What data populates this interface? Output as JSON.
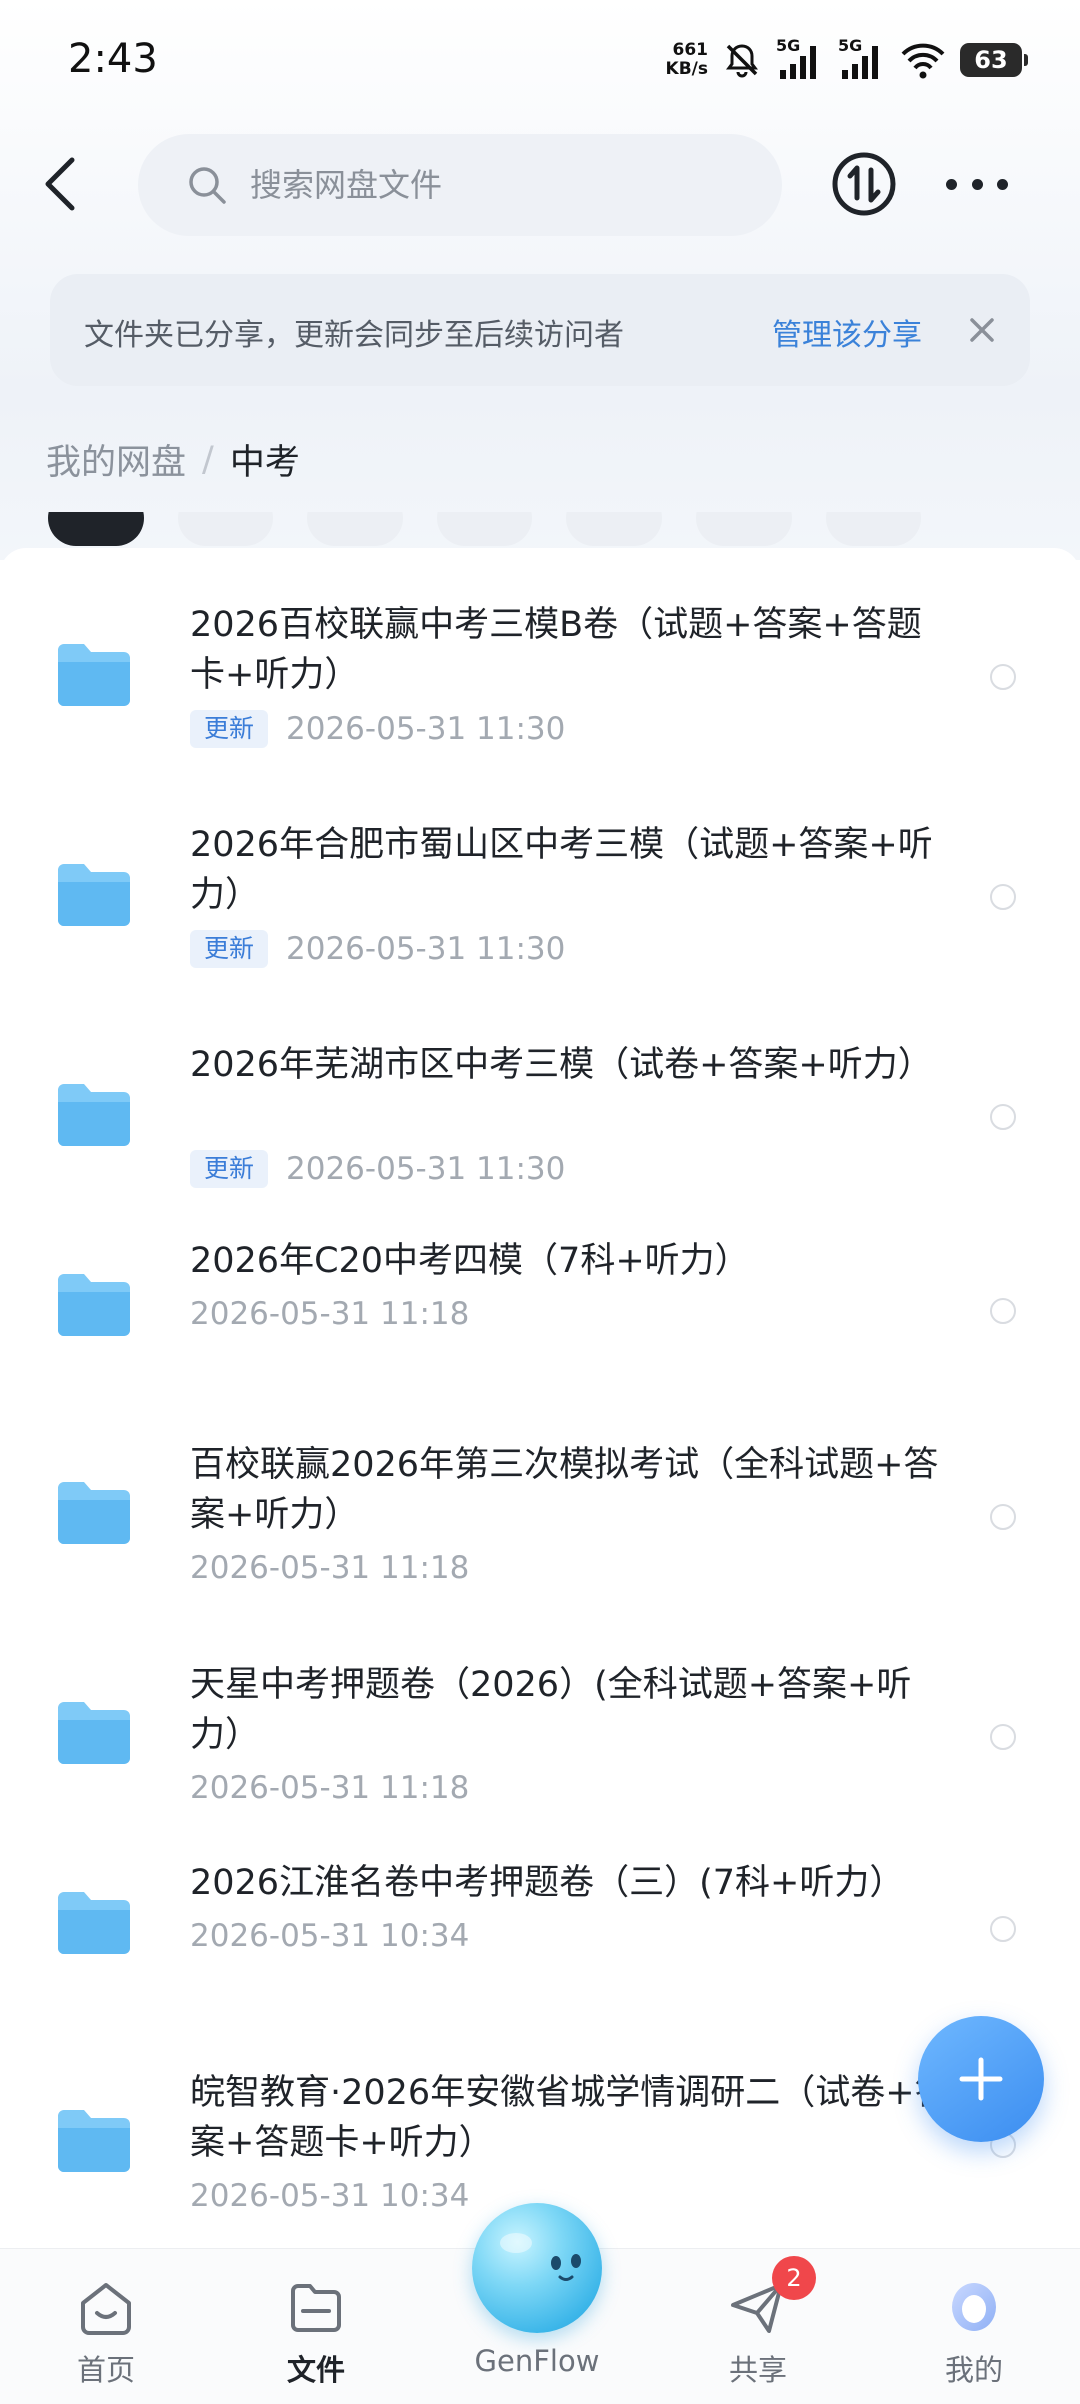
{
  "status": {
    "time": "2:43",
    "speed_value": "661",
    "speed_unit": "KB/s",
    "sim1": "5G",
    "sim2": "5G",
    "battery": "63"
  },
  "header": {
    "search_placeholder": "搜索网盘文件"
  },
  "notice": {
    "text": "文件夹已分享，更新会同步至后续访问者",
    "link": "管理该分享"
  },
  "breadcrumb": {
    "root": "我的网盘",
    "separator": "/",
    "current": "中考"
  },
  "files": [
    {
      "name": "2026百校联赢中考三模B卷（试题+答案+答题卡+听力）",
      "badge": "更新",
      "date": "2026-05-31  11:30"
    },
    {
      "name": "2026年合肥市蜀山区中考三模（试题+答案+听力）",
      "badge": "更新",
      "date": "2026-05-31  11:30"
    },
    {
      "name": "2026年芜湖市区中考三模（试卷+答案+听力）",
      "badge": "更新",
      "date": "2026-05-31  11:30"
    },
    {
      "name": "2026年C20中考四模（7科+听力）",
      "date": "2026-05-31  11:18"
    },
    {
      "name": "百校联赢2026年第三次模拟考试（全科试题+答案+听力）",
      "date": "2026-05-31  11:18"
    },
    {
      "name": "天星中考押题卷（2026）(全科试题+答案+听力）",
      "date": "2026-05-31  11:18"
    },
    {
      "name": "2026江淮名卷中考押题卷（三）(7科+听力）",
      "date": "2026-05-31  10:34"
    },
    {
      "name": "皖智教育·2026年安徽省城学情调研二（试卷+答案+答题卡+听力）",
      "date": "2026-05-31  10:34"
    }
  ],
  "nav": {
    "home": "首页",
    "files": "文件",
    "genflow": "GenFlow",
    "share": "共享",
    "share_badge": "2",
    "me": "我的"
  },
  "colors": {
    "accent": "#3b82d9",
    "folder": "#6cc0f5",
    "badge_red": "#f0474b"
  }
}
